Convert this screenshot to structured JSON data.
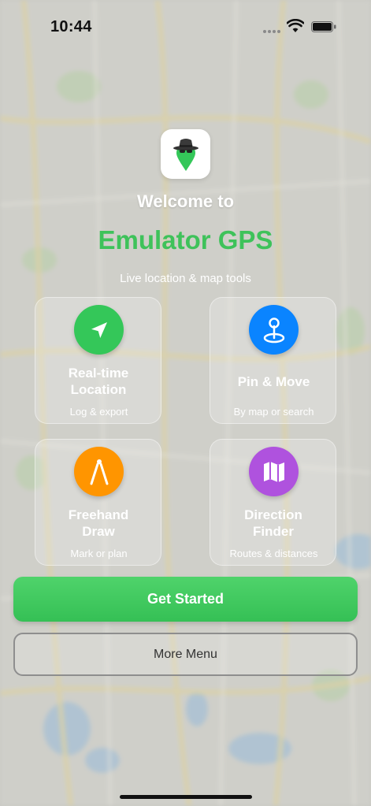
{
  "status_bar": {
    "time": "10:44"
  },
  "welcome": "Welcome to",
  "app_title": "Emulator GPS",
  "subtitle": "Live location & map tools",
  "features": [
    {
      "title": "Real-time Location",
      "desc": "Log & export",
      "color": "#34c759",
      "icon": "location-arrow-icon"
    },
    {
      "title": "Pin & Move",
      "desc": "By map or search",
      "color": "#0a84ff",
      "icon": "map-pin-icon"
    },
    {
      "title": "Freehand Draw",
      "desc": "Mark or plan",
      "color": "#ff9500",
      "icon": "compass-draw-icon"
    },
    {
      "title": "Direction Finder",
      "desc": "Routes & distances",
      "color": "#af52de",
      "icon": "folded-map-icon"
    }
  ],
  "buttons": {
    "primary": "Get Started",
    "secondary": "More Menu"
  },
  "colors": {
    "accent_green": "#3ec25a"
  }
}
